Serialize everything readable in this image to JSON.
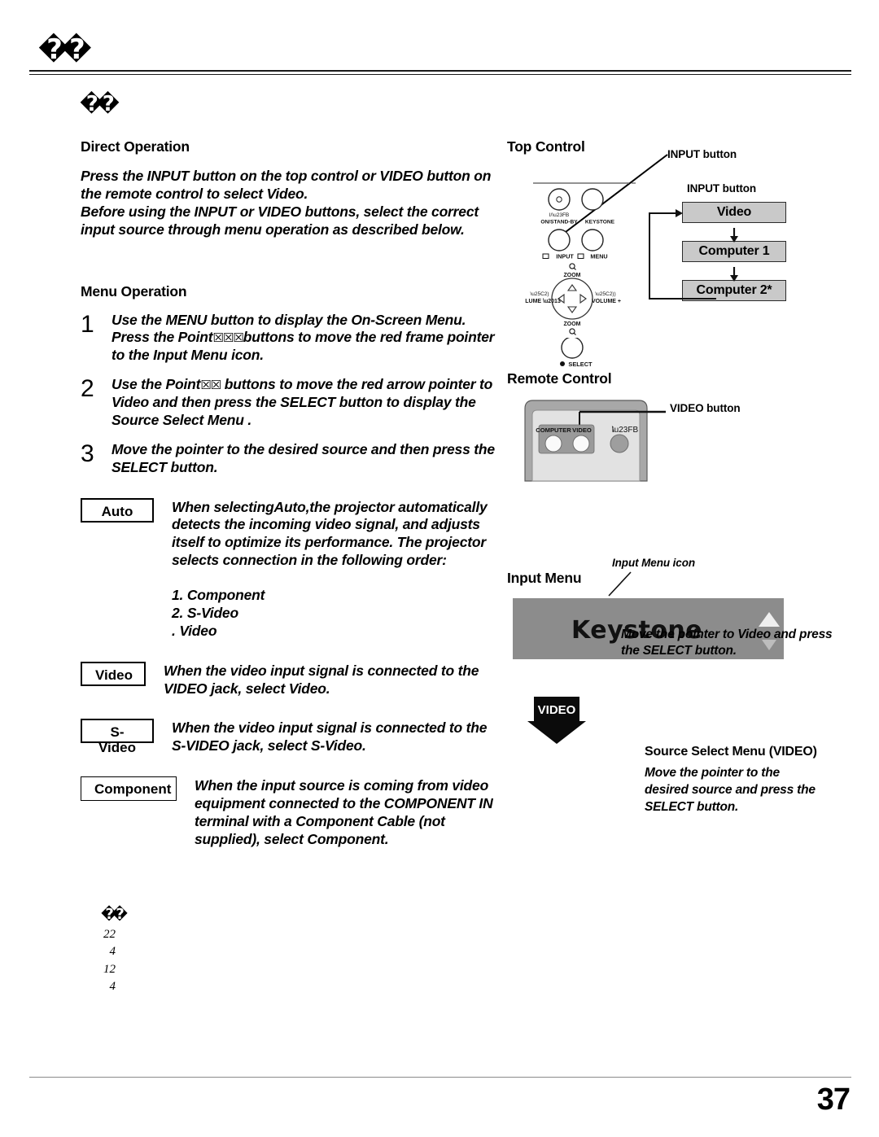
{
  "page": {
    "header_glyph": "��",
    "note_glyph": "��",
    "number": "37"
  },
  "left": {
    "direct_operation": {
      "heading": "Direct Operation",
      "paragraph1": "Press the INPUT button on the top control or VIDEO button on the remote control to select Video.",
      "paragraph2": "Before using the INPUT or VIDEO buttons, select the correct input source through menu operation as described below."
    },
    "menu_operation": {
      "heading": "Menu Operation",
      "steps": [
        {
          "num": "1",
          "text_a": "Use the MENU button to display the On-Screen Menu. Press the Point",
          "glyph": "☒☒☒",
          "text_b": "buttons to move the red frame pointer to the Input Menu icon."
        },
        {
          "num": "2",
          "text_a": "Use the Point",
          "glyph": "☒☒",
          "text_b": " buttons to move the red arrow pointer to Video and then press the SELECT button to display the Source Select Menu ."
        },
        {
          "num": "3",
          "text_a": "Move the pointer to the desired source and then press the SELECT button.",
          "glyph": "",
          "text_b": ""
        }
      ]
    },
    "sources": [
      {
        "label": "Auto",
        "desc": "When selectingAuto,the projector automatically detects the incoming video signal, and adjusts itself to optimize its performance. The projector selects connection in the following order:",
        "order": [
          "1. Component",
          "2. S-Video",
          ". Video"
        ]
      },
      {
        "label": "Video",
        "desc": "When the video input signal is connected to the VIDEO jack, select Video.",
        "order": []
      },
      {
        "label": "S-Video",
        "desc": "When the video input signal is connected to the S-VIDEO jack, select S-Video.",
        "order": []
      },
      {
        "label": "Component",
        "desc": "When the input source is coming from video equipment connected to the COMPONENT IN terminal with a Component Cable (not supplied), select Component.",
        "order": []
      }
    ],
    "footnote_numbers": [
      "22",
      "4",
      "12",
      "4"
    ]
  },
  "right": {
    "top_control": {
      "heading": "Top Control",
      "callout": "INPUT button",
      "flow_heading": "INPUT button",
      "flow_items": [
        "Video",
        "Computer 1",
        "Computer 2*"
      ],
      "panel_labels": {
        "standby": "ON/STAND-BY",
        "standby_sym": "I/⏻",
        "keystone": "KEYSTONE",
        "input": "INPUT",
        "menu": "MENU",
        "zoom_top": "ZOOM",
        "zoom_bottom": "ZOOM",
        "volume_minus": "VOLUME –",
        "volume_plus": "VOLUME +",
        "select": "SELECT"
      }
    },
    "remote_control": {
      "heading": "Remote Control",
      "callout": "VIDEO button",
      "buttons": [
        "COMPUTER",
        "VIDEO"
      ],
      "power_symbols": "I  ⏻"
    },
    "input_menu": {
      "heading": "Input Menu",
      "icon_callout": "Input Menu icon",
      "band_text": "Keystone",
      "band_caption": "Move the pointer to Video and press the SELECT button."
    },
    "source_select": {
      "arrow_label": "VIDEO",
      "title": "Source Select Menu (VIDEO)",
      "caption": "Move the pointer to the desired source and press the SELECT button."
    }
  },
  "colors": {
    "flow_box_fill": "#c9c9c9",
    "band_fill": "#8c8c8c",
    "remote_body": "#d4d4d4",
    "remote_shell": "#a8a8a8"
  }
}
